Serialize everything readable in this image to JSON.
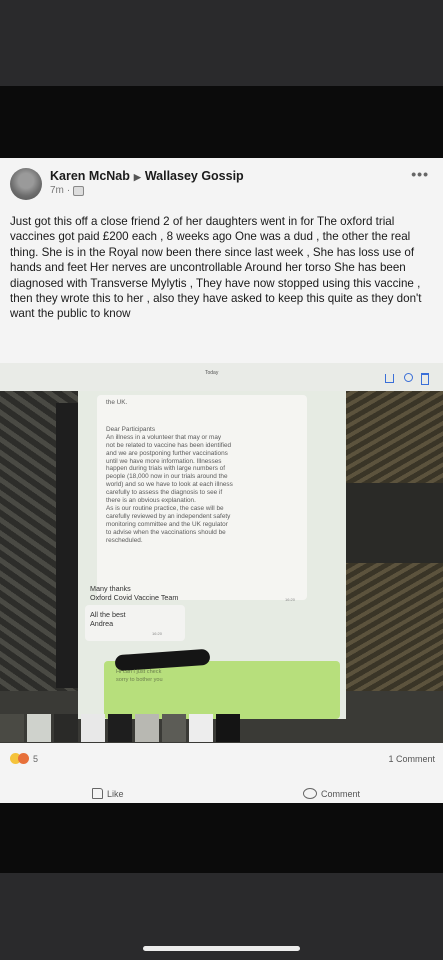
{
  "post": {
    "author": "Karen McNab",
    "group": "Wallasey Gossip",
    "time": "7m",
    "text": "Just got this off a close friend 2 of her daughters went in for The oxford trial vaccines got paid £200 each , 8 weeks ago One was a dud , the other the real thing. She is in the Royal now been there since last week , She has loss use of hands and feet Her nerves are uncontrollable Around her torso She has been diagnosed with Transverse Mylytis , They have now stopped using this vaccine , then they wrote this to her , also they have asked to keep this quite as they don't want the public to know"
  },
  "photo": {
    "today_label": "Today",
    "message_top": "the UK.",
    "message_lines": [
      "Dear Participants",
      "An illness in a volunteer that may or may",
      "not be related to vaccine has been identified",
      "and we are postponing further vaccinations",
      "until we have more information. Illnesses",
      "happen during trials with large numbers of",
      "people (18,000 now in our trials around the",
      "world) and so we have to look at each illness",
      "carefully to assess the diagnosis to see if",
      "there is an obvious explanation.",
      "As is our routine practice, the case will be",
      "carefully reviewed by an independent safety",
      "monitoring committee and the UK regulator",
      "to advise when the vaccinations should be",
      "rescheduled."
    ],
    "sign_line1": "Many thanks",
    "sign_line2": "Oxford Covid Vaccine Team",
    "time_1": "16:20",
    "best_line1": "All the best",
    "best_line2": "Andrea",
    "time_2": "16:20",
    "reply_line1": "Hi can I just check",
    "reply_line2": "sorry to bother you"
  },
  "footer": {
    "reaction_count": "5",
    "comments": "1 Comment",
    "like": "Like",
    "comment": "Comment"
  },
  "colors": {
    "accent": "#3a6fd8",
    "reply_bubble": "#b7df7c"
  }
}
